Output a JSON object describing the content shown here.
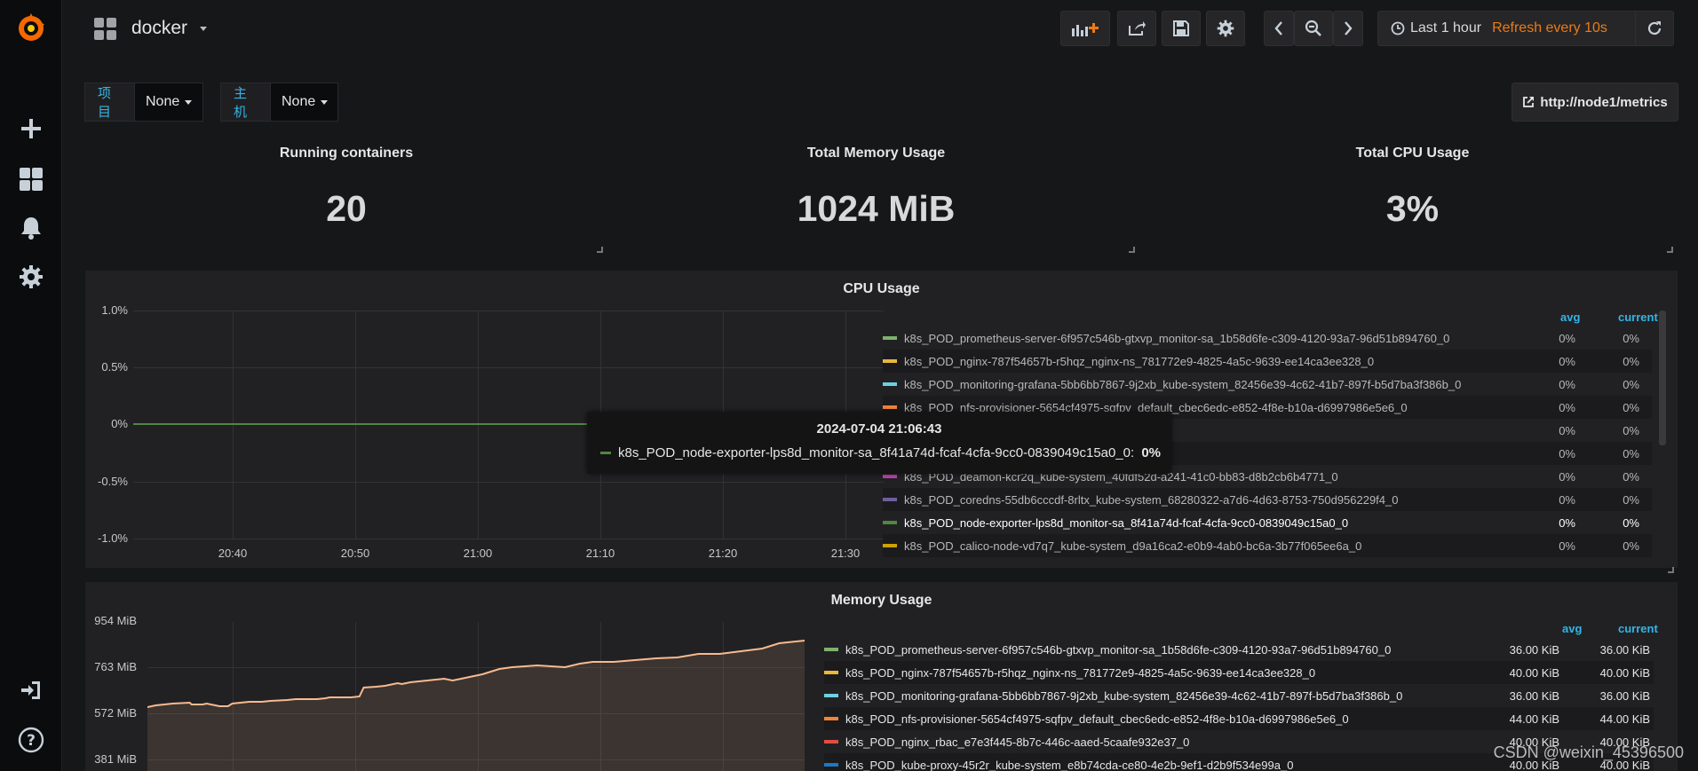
{
  "topbar": {
    "dashboard_title": "docker",
    "time_range": "Last 1 hour",
    "refresh": "Refresh every 10s"
  },
  "variables": [
    {
      "label": "项目",
      "value": "None"
    },
    {
      "label": "主机",
      "value": "None"
    }
  ],
  "link": {
    "label": "http://node1/metrics"
  },
  "stats": [
    {
      "title": "Running containers",
      "value": "20"
    },
    {
      "title": "Total Memory Usage",
      "value": "1024 MiB"
    },
    {
      "title": "Total CPU Usage",
      "value": "3%"
    }
  ],
  "cpu_panel": {
    "title": "CPU Usage",
    "y_ticks": [
      "1.0%",
      "0.5%",
      "0%",
      "-0.5%",
      "-1.0%"
    ],
    "x_ticks": [
      "20:40",
      "20:50",
      "21:00",
      "21:10",
      "21:20",
      "21:30"
    ],
    "legend_headers": {
      "avg": "avg",
      "current": "current"
    },
    "legend": [
      {
        "name": "k8s_POD_prometheus-server-6f957c546b-gtxvp_monitor-sa_1b58d6fe-c309-4120-93a7-96d51b894760_0",
        "color": "#7eb26d",
        "avg": "0%",
        "current": "0%"
      },
      {
        "name": "k8s_POD_nginx-787f54657b-r5hqz_nginx-ns_781772e9-4825-4a5c-9639-ee14ca3ee328_0",
        "color": "#eab839",
        "avg": "0%",
        "current": "0%"
      },
      {
        "name": "k8s_POD_monitoring-grafana-5bb6bb7867-9j2xb_kube-system_82456e39-4c62-41b7-897f-b5d7ba3f386b_0",
        "color": "#6ed0e0",
        "avg": "0%",
        "current": "0%"
      },
      {
        "name": "k8s_POD_nfs-provisioner-5654cf4975-sqfpv_default_cbec6edc-e852-4f8e-b10a-d6997986e5e6_0",
        "color": "#ef843c",
        "avg": "0%",
        "current": "0%"
      },
      {
        "name": "5caafe932e37_0",
        "color": "#e24d42",
        "avg": "0%",
        "current": "0%"
      },
      {
        "name": "cda-ce80-4e2b-9ef1-d2b9f534e99a_0",
        "color": "#1f78c1",
        "avg": "0%",
        "current": "0%"
      },
      {
        "name": "k8s_POD_deamon-kcr2q_kube-system_40fdf52d-a241-41c0-bb83-d8b2cb6b4771_0",
        "color": "#ba43a9",
        "avg": "0%",
        "current": "0%"
      },
      {
        "name": "k8s_POD_coredns-55db6cccdf-8rltx_kube-system_68280322-a7d6-4d63-8753-750d956229f4_0",
        "color": "#705da0",
        "avg": "0%",
        "current": "0%"
      },
      {
        "name": "k8s_POD_node-exporter-lps8d_monitor-sa_8f41a74d-fcaf-4cfa-9cc0-0839049c15a0_0",
        "color": "#508642",
        "avg": "0%",
        "current": "0%"
      },
      {
        "name": "k8s_POD_calico-node-vd7q7_kube-system_d9a16ca2-e0b9-4ab0-bc6a-3b77f065ee6a_0",
        "color": "#cca300",
        "avg": "0%",
        "current": "0%"
      }
    ],
    "tooltip": {
      "time": "2024-07-04 21:06:43",
      "series": "k8s_POD_node-exporter-lps8d_monitor-sa_8f41a74d-fcaf-4cfa-9cc0-0839049c15a0_0:",
      "value": "0%"
    }
  },
  "memory_panel": {
    "title": "Memory Usage",
    "y_ticks": [
      "954 MiB",
      "763 MiB",
      "572 MiB",
      "381 MiB"
    ],
    "legend_headers": {
      "avg": "avg",
      "current": "current"
    },
    "legend": [
      {
        "name": "k8s_POD_prometheus-server-6f957c546b-gtxvp_monitor-sa_1b58d6fe-c309-4120-93a7-96d51b894760_0",
        "color": "#7eb26d",
        "avg": "36.00 KiB",
        "current": "36.00 KiB"
      },
      {
        "name": "k8s_POD_nginx-787f54657b-r5hqz_nginx-ns_781772e9-4825-4a5c-9639-ee14ca3ee328_0",
        "color": "#eab839",
        "avg": "40.00 KiB",
        "current": "40.00 KiB"
      },
      {
        "name": "k8s_POD_monitoring-grafana-5bb6bb7867-9j2xb_kube-system_82456e39-4c62-41b7-897f-b5d7ba3f386b_0",
        "color": "#6ed0e0",
        "avg": "36.00 KiB",
        "current": "36.00 KiB"
      },
      {
        "name": "k8s_POD_nfs-provisioner-5654cf4975-sqfpv_default_cbec6edc-e852-4f8e-b10a-d6997986e5e6_0",
        "color": "#ef843c",
        "avg": "44.00 KiB",
        "current": "44.00 KiB"
      },
      {
        "name": "k8s_POD_nginx_rbac_e7e3f445-8b7c-446c-aaed-5caafe932e37_0",
        "color": "#e24d42",
        "avg": "40.00 KiB",
        "current": "40.00 KiB"
      },
      {
        "name": "k8s_POD_kube-proxy-45r2r_kube-system_e8b74cda-ce80-4e2b-9ef1-d2b9f534e99a_0",
        "color": "#1f78c1",
        "avg": "40.00 KiB",
        "current": "40.00 KiB"
      }
    ]
  },
  "watermark": "CSDN @weixin_45396500"
}
